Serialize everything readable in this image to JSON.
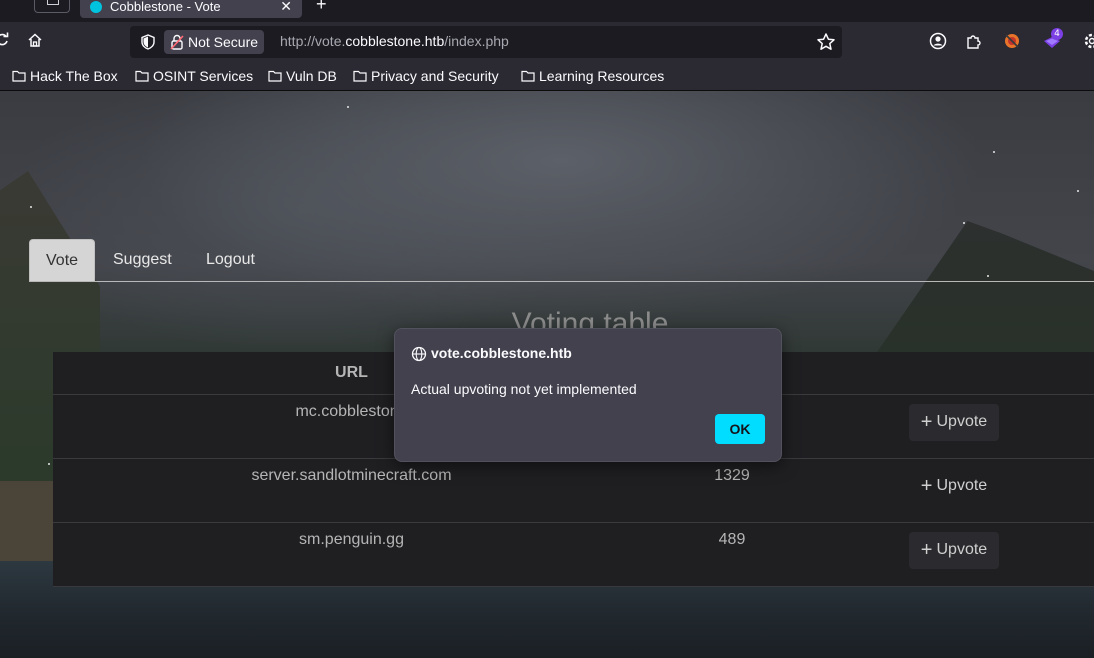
{
  "browser": {
    "tab_title": "Cobblestone - Vote",
    "tab_close": "✕",
    "new_tab": "+",
    "not_secure_label": "Not Secure",
    "url_prefix": "http://vote.",
    "url_domain": "cobblestone.htb",
    "url_path": "/index.php",
    "extension_badge": "4"
  },
  "bookmarks": [
    {
      "label": "Hack The Box"
    },
    {
      "label": "OSINT Services"
    },
    {
      "label": "Vuln DB"
    },
    {
      "label": "Privacy and Security"
    },
    {
      "label": "Learning Resources"
    }
  ],
  "site": {
    "tabs": [
      {
        "label": "Vote",
        "active": true
      },
      {
        "label": "Suggest"
      },
      {
        "label": "Logout"
      }
    ],
    "heading": "Voting table",
    "columns": [
      "URL"
    ],
    "rows": [
      {
        "url": "mc.cobblestone",
        "votes": "",
        "action": "Upvote"
      },
      {
        "url": "server.sandlotminecraft.com",
        "votes": "1329",
        "action": "Upvote"
      },
      {
        "url": "sm.penguin.gg",
        "votes": "489",
        "action": "Upvote"
      }
    ]
  },
  "dialog": {
    "title": "vote.cobblestone.htb",
    "message": "Actual upvoting not yet implemented",
    "ok_label": "OK"
  },
  "colors": {
    "accent": "#00ddff",
    "chrome_bg": "#2b2a33"
  }
}
